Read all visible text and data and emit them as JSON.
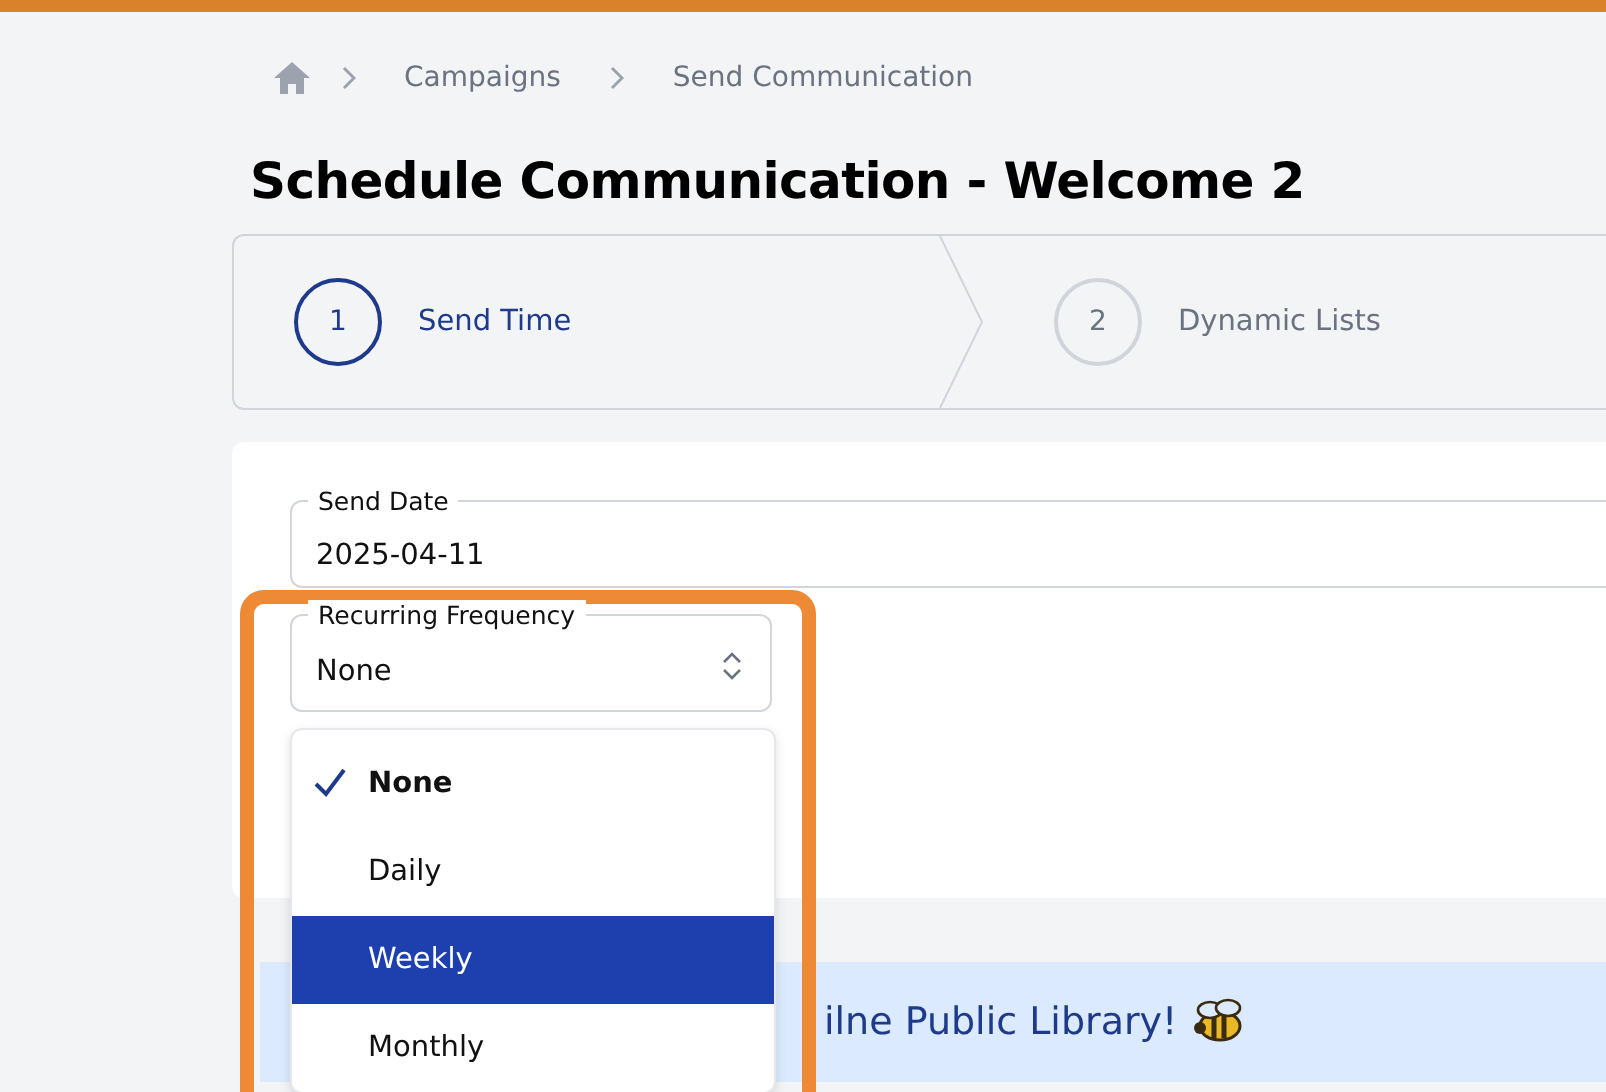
{
  "breadcrumb": [
    "Campaigns",
    "Send Communication"
  ],
  "title": "Schedule Communication - Welcome 2",
  "steps": [
    {
      "number": "1",
      "label": "Send Time",
      "selected": true
    },
    {
      "number": "2",
      "label": "Dynamic Lists",
      "selected": false
    }
  ],
  "send_date": {
    "label": "Send Date",
    "value": "2025-04-11"
  },
  "recurring_frequency": {
    "label": "Recurring Frequency",
    "value": "None",
    "expanded": true,
    "options": [
      {
        "label": "None",
        "selected": true,
        "hovered": false
      },
      {
        "label": "Daily",
        "selected": false,
        "hovered": false
      },
      {
        "label": "Weekly",
        "selected": false,
        "hovered": true
      },
      {
        "label": "Monthly",
        "selected": false,
        "hovered": false
      }
    ]
  },
  "banner": {
    "text": "ilne Public Library!"
  }
}
